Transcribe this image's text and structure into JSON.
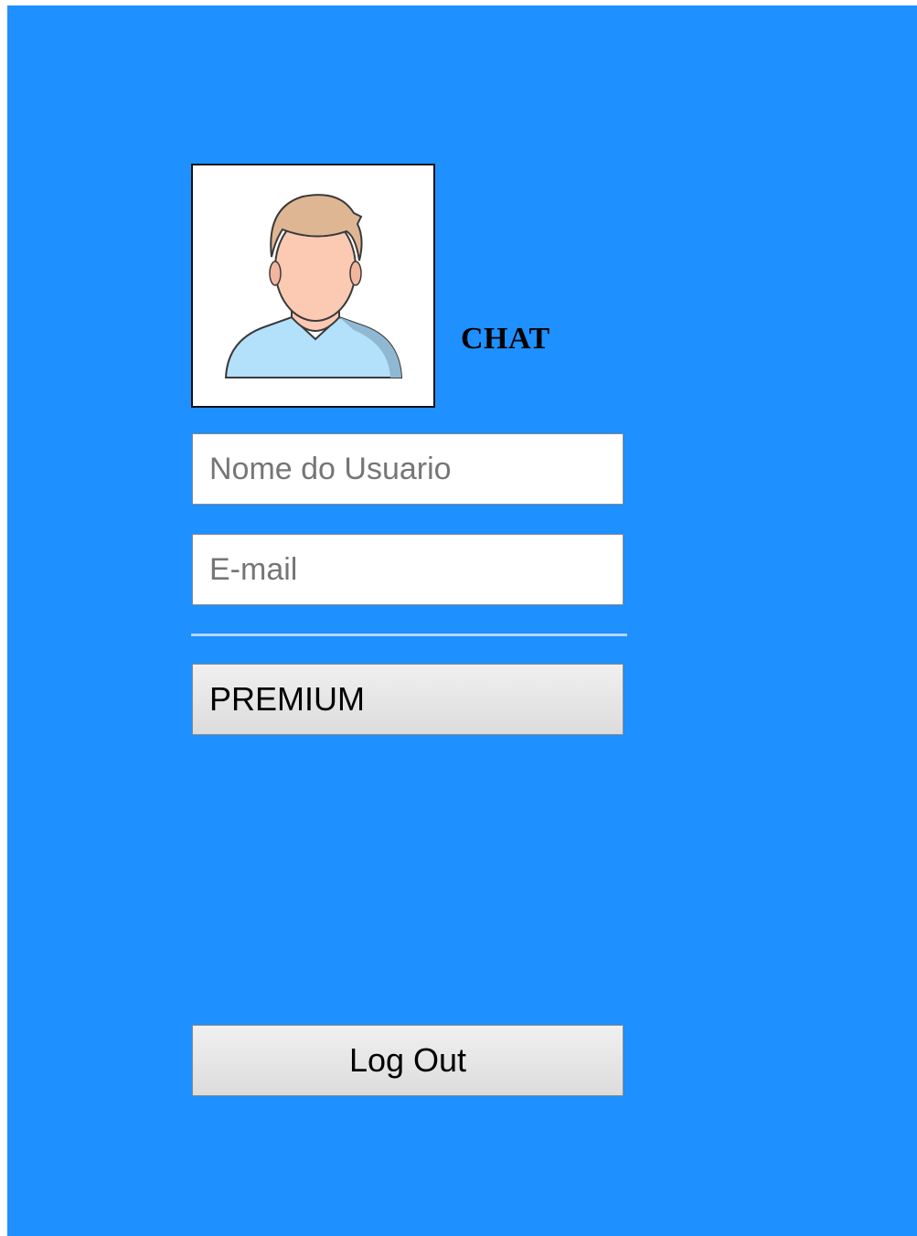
{
  "app": {
    "title": "CHAT"
  },
  "avatar": {
    "icon": "user-avatar-icon"
  },
  "form": {
    "username_placeholder": "Nome do Usuario",
    "username_value": "",
    "email_placeholder": "E-mail",
    "email_value": ""
  },
  "buttons": {
    "premium_label": "PREMIUM",
    "logout_label": "Log Out"
  },
  "colors": {
    "background": "#1e90ff",
    "skin": "#fcc9b3",
    "hair": "#dfb693",
    "shirt": "#b3e0fa"
  }
}
